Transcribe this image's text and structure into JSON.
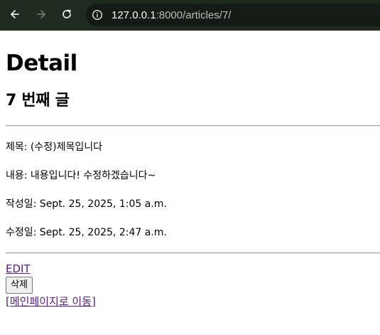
{
  "browser": {
    "url_host": "127.0.0.1",
    "url_path": ":8000/articles/7/"
  },
  "page": {
    "heading": "Detail",
    "article_heading": "7 번째 글",
    "fields": {
      "title": "제목: (수정)제목입니다",
      "content": "내용: 내용입니다! 수정하겠습니다~",
      "created_at": "작성일: Sept. 25, 2025, 1:05 a.m.",
      "updated_at": "수정일: Sept. 25, 2025, 2:47 a.m."
    },
    "edit_link": "EDIT",
    "delete_button": "삭제",
    "home_link": "[메인페이지로 이동]"
  },
  "colors": {
    "toolbar_bg": "#1f2b1f",
    "visited_link": "#551a8b"
  }
}
